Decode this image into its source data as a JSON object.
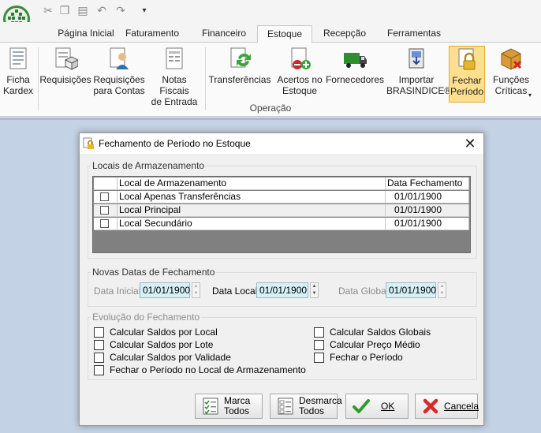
{
  "ribbon": {
    "tabs": [
      "Página Inicial",
      "Faturamento",
      "Financeiro",
      "Estoque",
      "Recepção",
      "Ferramentas"
    ],
    "active_tab": "Estoque",
    "buttons": {
      "ficha_kardex": "Ficha\nKardex",
      "requisicoes": "Requisições",
      "requisicoes_contas": "Requisições\npara Contas",
      "notas_fiscais": "Notas Fiscais\nde Entrada",
      "transferencias": "Transferências",
      "acertos_estoque": "Acertos no\nEstoque",
      "fornecedores": "Fornecedores",
      "importar_brasindice": "Importar\nBRASINDICE®",
      "fechar_periodo": "Fechar\nPeríodo",
      "funcoes_criticas": "Funções\nCríticas"
    },
    "group_label": "Operação"
  },
  "dialog": {
    "title": "Fechamento de Período no Estoque",
    "locais": {
      "caption": "Locais de Armazenamento",
      "columns": [
        "Local de Armazenamento",
        "Data Fechamento"
      ],
      "rows": [
        {
          "name": "Local Apenas Transferências",
          "date": "01/01/1900"
        },
        {
          "name": "Local Principal",
          "date": "01/01/1900"
        },
        {
          "name": "Local Secundário",
          "date": "01/01/1900"
        }
      ]
    },
    "novas_datas": {
      "caption": "Novas Datas de Fechamento",
      "inicial_label": "Data Inicial",
      "inicial_value": "01/01/1900",
      "local_label": "Data Local",
      "local_value": "01/01/1900",
      "global_label": "Data Global",
      "global_value": "01/01/1900"
    },
    "evolucao": {
      "caption": "Evolução do Fechamento",
      "left": [
        "Calcular Saldos por Local",
        "Calcular Saldos por Lote",
        "Calcular Saldos por Validade",
        "Fechar o Período no Local de Armazenamento"
      ],
      "right": [
        "Calcular Saldos Globais",
        "Calcular Preço Médio",
        "Fechar o Período"
      ]
    },
    "buttons": {
      "marca_todos": "Marca\nTodos",
      "desmarca_todos": "Desmarca\nTodos",
      "ok": "OK",
      "cancela": "Cancela"
    }
  }
}
